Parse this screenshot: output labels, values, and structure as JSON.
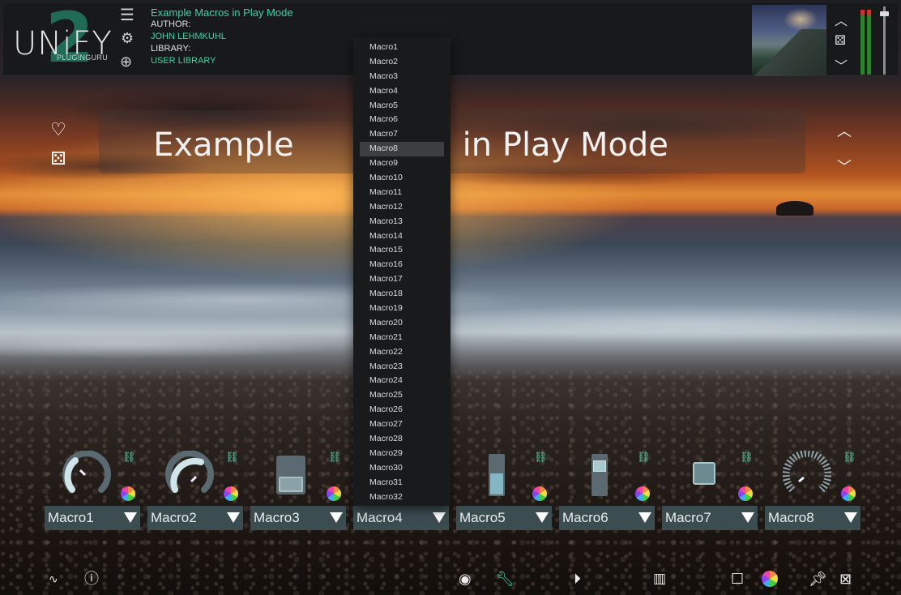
{
  "header": {
    "logo_text": "UNiFY",
    "logo_sub": "PLUGINGURU",
    "logo_number": "2",
    "preset_title": "Example Macros in Play Mode",
    "author_label": "AUTHOR:",
    "author_value": "JOHN LEHMKUHL",
    "library_label": "LIBRARY:",
    "library_value": "USER LIBRARY",
    "icons": [
      "menu-icon",
      "gear-icon",
      "add-icon",
      "chevron-up-icon",
      "dice-icon",
      "chevron-down-icon"
    ],
    "meter_icon": "level-meter"
  },
  "preset_display": {
    "left_text": "Example",
    "right_text": "os in Play Mode",
    "icons": [
      "heart-icon",
      "dice-icon",
      "chevron-up-icon",
      "chevron-down-icon"
    ]
  },
  "dropdown": {
    "highlighted": "Macro8",
    "options": [
      "Macro1",
      "Macro2",
      "Macro3",
      "Macro4",
      "Macro5",
      "Macro6",
      "Macro7",
      "Macro8",
      "Macro9",
      "Macro10",
      "Macro11",
      "Macro12",
      "Macro13",
      "Macro14",
      "Macro15",
      "Macro16",
      "Macro17",
      "Macro18",
      "Macro19",
      "Macro20",
      "Macro21",
      "Macro22",
      "Macro23",
      "Macro24",
      "Macro25",
      "Macro26",
      "Macro27",
      "Macro28",
      "Macro29",
      "Macro30",
      "Macro31",
      "Macro32"
    ]
  },
  "macros": [
    {
      "label": "Macro1",
      "control": "knob",
      "value": 0.4
    },
    {
      "label": "Macro2",
      "control": "knob",
      "value": 0.65
    },
    {
      "label": "Macro3",
      "control": "button",
      "value": 1
    },
    {
      "label": "Macro4",
      "control": "hidden",
      "value": 0
    },
    {
      "label": "Macro5",
      "control": "slider",
      "value": 0.55
    },
    {
      "label": "Macro6",
      "control": "slider",
      "value": 0.85
    },
    {
      "label": "Macro7",
      "control": "square-button",
      "value": 1
    },
    {
      "label": "Macro8",
      "control": "dotted-knob",
      "value": 0.3
    }
  ],
  "colors": {
    "accent": "#3fd2a4",
    "macro_bg": "#3c4d52",
    "header_bg": "#17191b"
  },
  "toolbar": {
    "icons": [
      "waveform-icon",
      "info-icon",
      "target-icon",
      "wrench-icon",
      "play-icon",
      "piano-icon",
      "square-icon",
      "color-wheel-icon",
      "pin-icon",
      "image-icon"
    ]
  }
}
